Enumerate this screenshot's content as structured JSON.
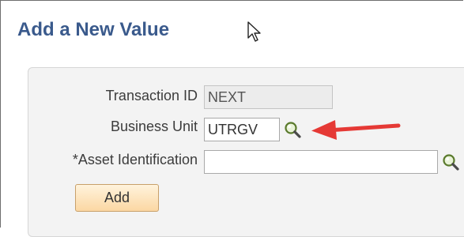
{
  "page": {
    "title": "Add a New Value"
  },
  "form": {
    "transaction_id": {
      "label": "Transaction ID",
      "value": "NEXT"
    },
    "business_unit": {
      "label": "Business Unit",
      "value": "UTRGV"
    },
    "asset_identification": {
      "label": "*Asset Identification",
      "value": ""
    },
    "add_button_label": "Add"
  },
  "annotation": {
    "arrow_color": "#e53935"
  },
  "colors": {
    "title": "#3a5a8c",
    "panel_background": "#f3f3f3",
    "button_background": "#fbd7a3"
  }
}
